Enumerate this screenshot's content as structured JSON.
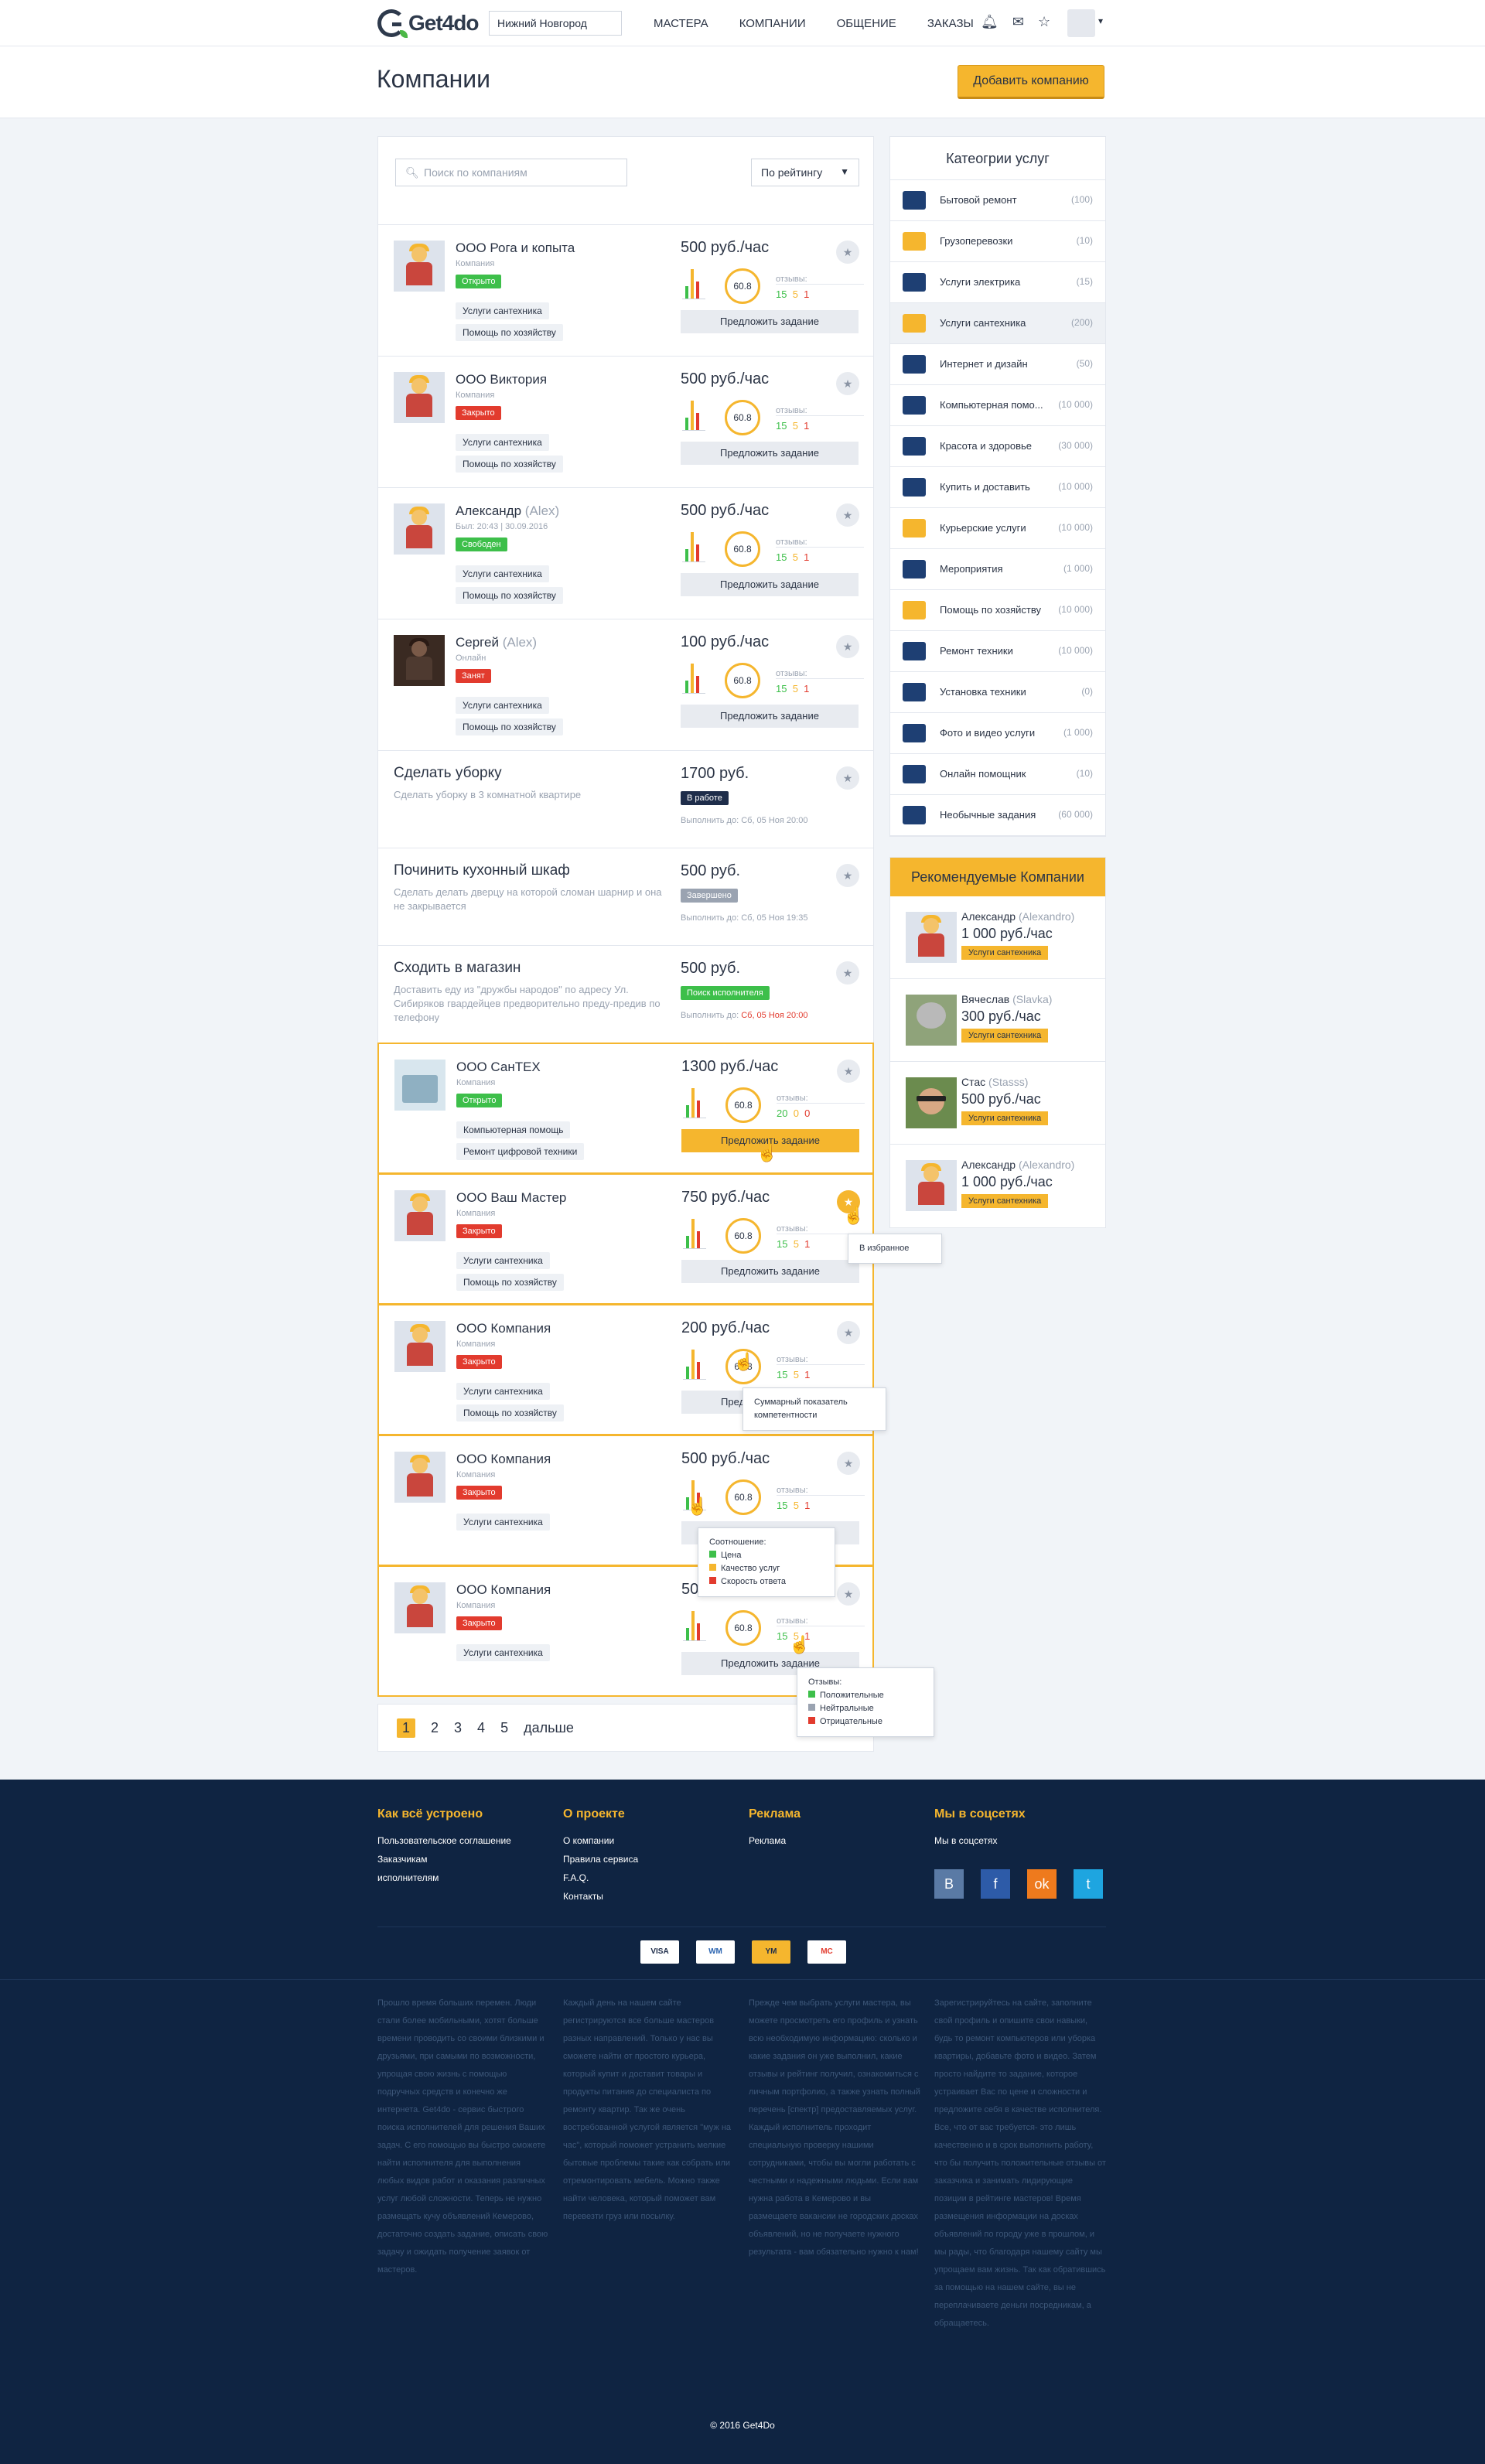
{
  "header": {
    "logo": "Get4do",
    "city": "Нижний Новгород",
    "nav": [
      "МАСТЕРА",
      "КОМПАНИИ",
      "ОБЩЕНИЕ",
      "ЗАКАЗЫ"
    ],
    "icons": [
      "bell-icon",
      "mail-icon",
      "star-icon"
    ]
  },
  "page": {
    "title": "Компании",
    "add_button": "Добавить компанию"
  },
  "toolbar": {
    "search_placeholder": "Поиск по компаниям",
    "sort": "По рейтингу"
  },
  "rows": [
    {
      "name": "ООО Рога и копыта",
      "sub": "Компания",
      "status": "Открыто",
      "status_color": "green",
      "tags": [
        "Услуги сантехника",
        "Помощь по хозяйству"
      ],
      "price": "500 руб./час",
      "score": "60.8",
      "reviews_label": "отзывы:",
      "pos": "15",
      "neu": "5",
      "neg": "1",
      "offer": "Предложить задание"
    },
    {
      "name": "ООО Виктория",
      "sub": "Компания",
      "status": "Закрыто",
      "status_color": "red",
      "tags": [
        "Услуги сантехника",
        "Помощь по хозяйству"
      ],
      "price": "500 руб./час",
      "score": "60.8",
      "reviews_label": "отзывы:",
      "pos": "15",
      "neu": "5",
      "neg": "1",
      "offer": "Предложить задание"
    },
    {
      "name": "Александр",
      "alias": "(Alex)",
      "sub": "Был: 20:43 | 30.09.2016",
      "status": "Свободен",
      "status_color": "green",
      "tags": [
        "Услуги сантехника",
        "Помощь по хозяйству"
      ],
      "price": "500 руб./час",
      "score": "60.8",
      "reviews_label": "отзывы:",
      "pos": "15",
      "neu": "5",
      "neg": "1",
      "offer": "Предложить задание"
    },
    {
      "name": "Сергей",
      "alias": "(Alex)",
      "sub": "Онлайн",
      "status": "Занят",
      "status_color": "red",
      "tags": [
        "Услуги сантехника",
        "Помощь по хозяйству"
      ],
      "price": "100 руб./час",
      "score": "60.8",
      "reviews_label": "отзывы:",
      "pos": "15",
      "neu": "5",
      "neg": "1",
      "offer": "Предложить задание"
    }
  ],
  "tasks": [
    {
      "title": "Сделать уборку",
      "desc": "Сделать уборку в 3 комнатной квартире",
      "price": "1700 руб.",
      "status": "В работе",
      "due_label": "Выполнить до:",
      "due": "Сб, 05 Ноя 20:00"
    },
    {
      "title": "Починить кухонный шкаф",
      "desc": "Сделать делать дверцу на которой сломан шарнир и она не закрывается",
      "price": "500 руб.",
      "status": "Завершено",
      "due_label": "Выполнить до:",
      "due": "Сб, 05 Ноя 19:35"
    },
    {
      "title": "Сходить в магазин",
      "desc": "Доставить еду из \"дружбы народов\" по адресу Ул. Сибиряков гвардейцев предворительно преду-предив по телефону",
      "price": "500 руб.",
      "status": "Поиск исполнителя",
      "due_label": "Выполнить до:",
      "due": "Сб, 05 Ноя 20:00"
    }
  ],
  "hl_rows": [
    {
      "name": "ООО СанТЕХ",
      "sub": "Компания",
      "status": "Открыто",
      "tags": [
        "Компьютерная помощь",
        "Ремонт цифровой техники"
      ],
      "price": "1300 руб./час",
      "score": "60.8",
      "reviews_label": "отзывы:",
      "pos": "20",
      "neu": "0",
      "neg": "0",
      "offer": "Предложить задание"
    },
    {
      "name": "ООО Ваш Мастер",
      "sub": "Компания",
      "status": "Закрыто",
      "tags": [
        "Услуги сантехника",
        "Помощь по хозяйству"
      ],
      "price": "750 руб./час",
      "score": "60.8",
      "reviews_label": "отзывы:",
      "pos": "15",
      "neu": "5",
      "neg": "1",
      "offer": "Предложить задание"
    },
    {
      "name": "ООО Компания",
      "sub": "Компания",
      "status": "Закрыто",
      "tags": [
        "Услуги сантехника",
        "Помощь по хозяйству"
      ],
      "price": "200 руб./час",
      "score": "60.8",
      "reviews_label": "отзывы:",
      "pos": "15",
      "neu": "5",
      "neg": "1",
      "offer": "Предложить задание"
    },
    {
      "name": "ООО Компания",
      "sub": "Компания",
      "status": "Закрыто",
      "tags": [
        "Услуги сантехника"
      ],
      "price": "500 руб./час",
      "score": "60.8",
      "reviews_label": "отзывы:",
      "pos": "15",
      "neu": "5",
      "neg": "1",
      "offer": "Предложить задание"
    },
    {
      "name": "ООО Компания",
      "sub": "Компания",
      "status": "Закрыто",
      "tags": [
        "Услуги сантехника"
      ],
      "price": "500 руб./час",
      "score": "60.8",
      "reviews_label": "отзывы:",
      "pos": "15",
      "neu": "5",
      "neg": "1",
      "offer": "Предложить задание"
    }
  ],
  "tooltips": {
    "fav": "В избранное",
    "score": "Суммарный показатель компетентности",
    "ratio_title": "Соотношение:",
    "ratio": [
      "Цена",
      "Качество услуг",
      "Скорость ответа"
    ],
    "reviews_title": "Отзывы:",
    "reviews": [
      "Положительные",
      "Нейтральные",
      "Отрицательные"
    ]
  },
  "pager": {
    "pages": [
      "1",
      "2",
      "3",
      "4",
      "5"
    ],
    "next": "дальше"
  },
  "categories": {
    "title": "Катеогрии услуг",
    "items": [
      {
        "label": "Бытовой ремонт",
        "count": "(100)",
        "color": "#1e3f73"
      },
      {
        "label": "Грузоперевозки",
        "count": "(10)",
        "color": "#f5b62e"
      },
      {
        "label": "Услуги электрика",
        "count": "(15)",
        "color": "#1e3f73"
      },
      {
        "label": "Услуги сантехника",
        "count": "(200)",
        "color": "#f5b62e"
      },
      {
        "label": "Интернет и дизайн",
        "count": "(50)",
        "color": "#1e3f73"
      },
      {
        "label": "Компьютерная помо...",
        "count": "(10 000)",
        "color": "#1e3f73"
      },
      {
        "label": "Красота и здоровье",
        "count": "(30 000)",
        "color": "#1e3f73"
      },
      {
        "label": "Купить и доставить",
        "count": "(10 000)",
        "color": "#1e3f73"
      },
      {
        "label": "Курьерские услуги",
        "count": "(10 000)",
        "color": "#f5b62e"
      },
      {
        "label": "Мероприятия",
        "count": "(1 000)",
        "color": "#1e3f73"
      },
      {
        "label": "Помощь по хозяйству",
        "count": "(10 000)",
        "color": "#f5b62e"
      },
      {
        "label": "Ремонт техники",
        "count": "(10 000)",
        "color": "#1e3f73"
      },
      {
        "label": "Установка техники",
        "count": "(0)",
        "color": "#1e3f73"
      },
      {
        "label": "Фото и видео услуги",
        "count": "(1 000)",
        "color": "#1e3f73"
      },
      {
        "label": "Онлайн помощник",
        "count": "(10)",
        "color": "#1e3f73"
      },
      {
        "label": "Необычные задания",
        "count": "(60 000)",
        "color": "#1e3f73"
      }
    ]
  },
  "recommended": {
    "title": "Рекомендуемые Компании",
    "items": [
      {
        "name": "Александр",
        "alias": "(Alexandro)",
        "price": "1 000 руб./час",
        "tag": "Услуги сантехника"
      },
      {
        "name": "Вячеслав",
        "alias": "(Slavka)",
        "price": "300 руб./час",
        "tag": "Услуги сантехника"
      },
      {
        "name": "Стас",
        "alias": "(Stasss)",
        "price": "500 руб./час",
        "tag": "Услуги сантехника"
      },
      {
        "name": "Александр",
        "alias": "(Alexandro)",
        "price": "1 000 руб./час",
        "tag": "Услуги сантехника"
      }
    ]
  },
  "footer": {
    "cols": [
      {
        "title": "Как всё устроено",
        "links": [
          "Пользовательское соглашение",
          "Заказчикам",
          "исполнителям"
        ]
      },
      {
        "title": "О проекте",
        "links": [
          "О компании",
          "Правила сервиса",
          "F.A.Q.",
          "Контакты"
        ]
      },
      {
        "title": "Реклама",
        "links": [
          "Реклама"
        ]
      },
      {
        "title": "Мы в соцсетях",
        "links": [
          "Мы в соцсетях"
        ]
      }
    ],
    "social": [
      "В",
      "f",
      "ok",
      "t"
    ],
    "payments": [
      "VISA",
      "WM",
      "YM",
      "MC"
    ],
    "texts": [
      "Прошло время больших перемен. Люди стали более мобильными, хотят больше времени проводить со своими близкими и друзьями, при самыми по возможности, упрощая свою жизнь с помощью подручных средств и конечно же интернета. Get4do - сервис быстрого поиска исполнителей для решения Ваших задач. С его помощью вы быстро сможете найти исполнителя для выполнения любых видов работ и оказания различных услуг любой сложности. Теперь не нужно размещать кучу объявлений Кемерово, достаточно создать задание, описать свою задачу и ожидать получение заявок от мастеров.",
      "Каждый день на нашем сайте регистрируются все больше мастеров разных направлений. Только у нас вы сможете найти от простого курьера, который купит и доставит товары и продукты питания до специалиста по ремонту квартир. Так же очень востребованной услугой является \"муж на час\", который поможет устранить мелкие бытовые проблемы такие как собрать или отремонтировать мебель. Можно также найти человека, который поможет вам перевезти груз или посылку.",
      "Прежде чем выбрать услуги мастера, вы можете просмотреть его профиль и узнать всю необходимую информацию: сколько и какие задания он уже выполнил, какие отзывы и рейтинг получил, ознакомиться с личным портфолио, а также узнать полный перечень [спектр] предоставляемых услуг. Каждый исполнитель проходит специальную проверку нашими сотрудниками, чтобы вы могли работать с честными и надежными людьми. Если вам нужна работа в Кемерово и вы размещаете вакансии не городских досках объявлений, но не получаете нужного результата - вам обязательно нужно к нам!",
      "Зарегистрируйтесь на сайте, заполните свой профиль и опишите свои навыки, будь то ремонт компьютеров или уборка квартиры, добавьте фото и видео. Затем просто найдите то задание, которое устраивает Вас по цене и сложности и предложите себя в качестве исполнителя. Все, что от вас требуется- это лишь качественно и в срок выполнить работу, что бы получить положительные отзывы от заказчика и занимать лидирующие позиции в рейтинге мастеров! Время размещения информации на досках объявлений по городу уже в прошлом, и мы рады, что благодаря нашему сайту мы упрощаем вам жизнь. Так как обратившись за помощью на нашем сайте, вы не переплачиваете деньги посредникам, а обращаетесь."
    ],
    "copyright": "© 2016 Get4Do"
  },
  "colors": {
    "accent": "#f5b62e",
    "dark": "#0f2442",
    "green": "#3dbf4a",
    "red": "#e23b2e"
  }
}
